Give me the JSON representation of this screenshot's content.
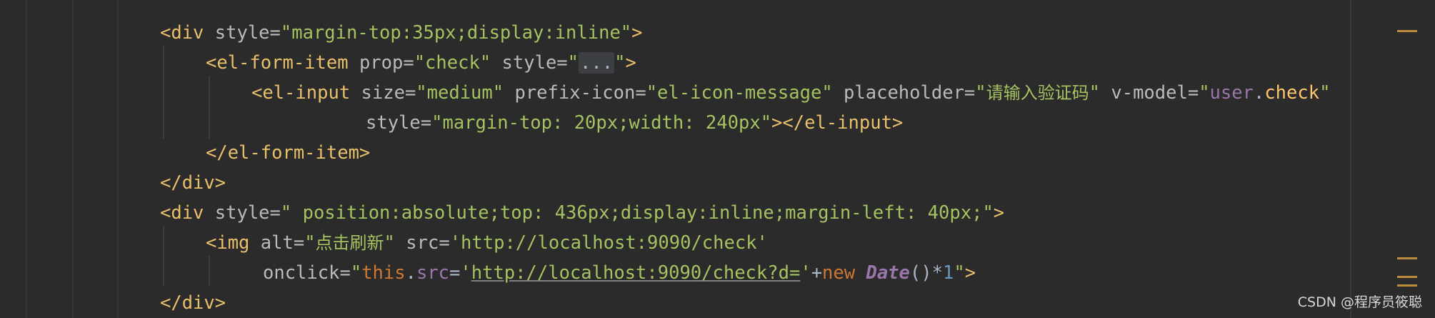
{
  "editor": {
    "line1": {
      "open": "<div ",
      "attr": "style=",
      "val": "\"margin-top:35px;display:inline\"",
      "close": ">"
    },
    "line2": {
      "open": "<el-form-item ",
      "attr1": "prop=",
      "val1": "\"check\" ",
      "attr2": "style=",
      "q1": "\"",
      "folded": "...",
      "q2": "\"",
      "close": ">"
    },
    "line3": {
      "open": "<el-input ",
      "attr1": "size=",
      "val1": "\"medium\" ",
      "attr2": "prefix-icon=",
      "val2": "\"el-icon-message\" ",
      "attr3": "placeholder=",
      "q1": "\"",
      "cjk": "请输入验证码",
      "q2": "\" ",
      "attr4": "v-model=",
      "q3": "\"",
      "obj": "user",
      "dot": ".",
      "field": "check",
      "q4": "\""
    },
    "line4": {
      "attr": "style=",
      "val": "\"margin-top: 20px;width: 240px\"",
      "close": "></el-input>"
    },
    "line5": {
      "tag": "</el-form-item>"
    },
    "line6": {
      "tag": "</div>"
    },
    "line7": {
      "open": "<div ",
      "attr": "style=",
      "val": "\" position:absolute;top: 436px;display:inline;margin-left: 40px;\"",
      "close": ">"
    },
    "line8": {
      "open": "<img ",
      "attr1": "alt=",
      "q1": "\"",
      "cjk": "点击刷新",
      "q2": "\" ",
      "attr2": "src=",
      "val2": "'http://localhost:9090/check'"
    },
    "line9": {
      "attr": "onclick=",
      "q1": "\"",
      "this": "this",
      "dot": ".",
      "src": "src",
      "eq": "=",
      "sq1": "'",
      "url": "http://localhost:9090/check?d=",
      "sq2": "'",
      "plus": "+",
      "new": "new ",
      "cls": "Date",
      "paren": "()",
      "star": "*",
      "num": "1",
      "q2": "\"",
      "close": ">"
    },
    "line10": {
      "tag": "</div>"
    }
  },
  "watermark": "CSDN @程序员筱聪",
  "colors": {
    "background": "#2b2b2b",
    "tag": "#e8bf6a",
    "attribute": "#bababa",
    "string": "#a5c261",
    "keyword": "#cc7832",
    "property": "#9876aa",
    "number": "#6897bb"
  }
}
